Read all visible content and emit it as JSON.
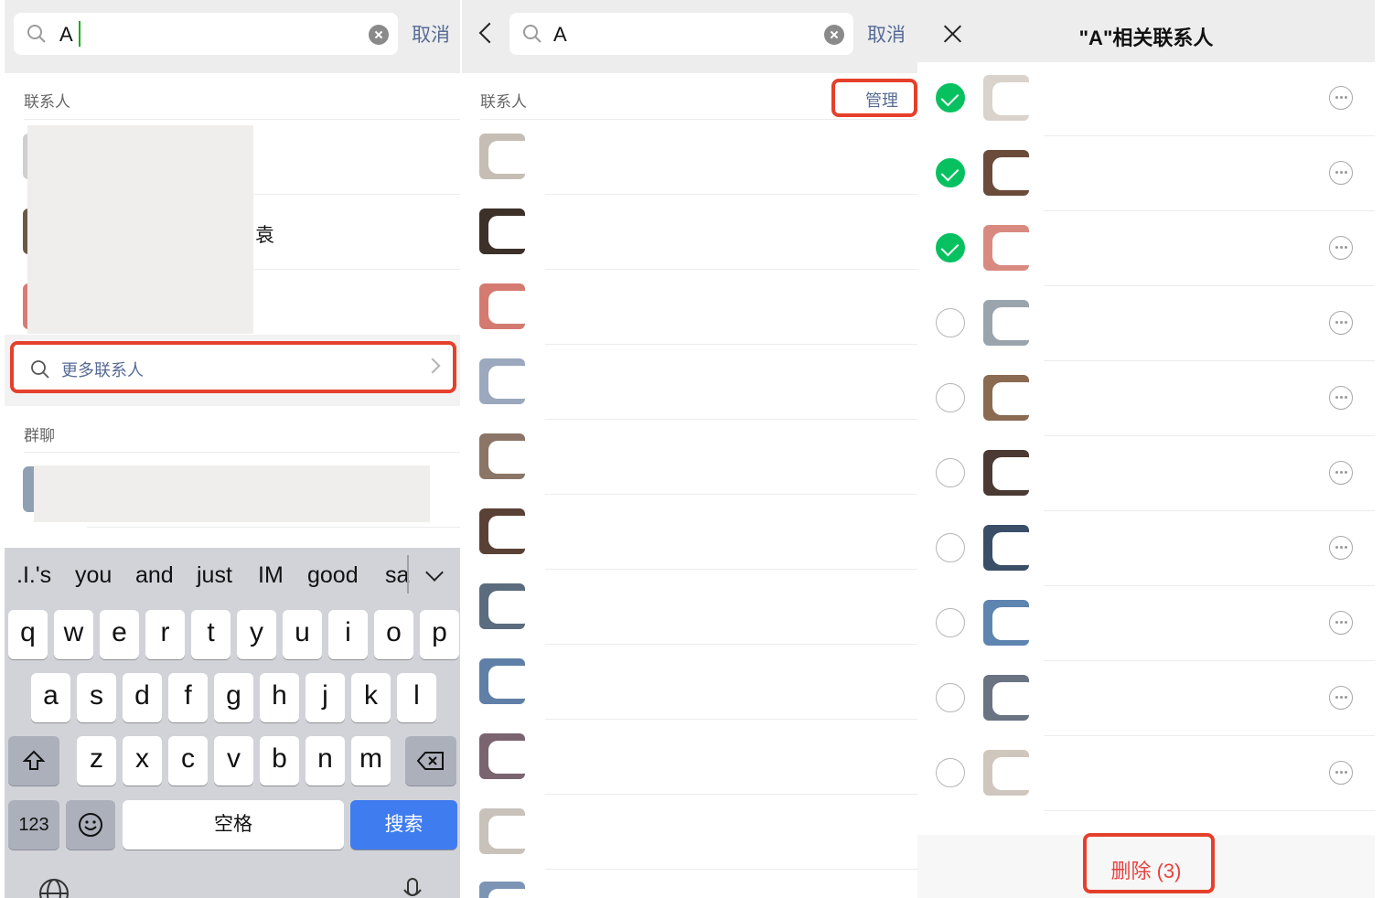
{
  "panel1": {
    "search": {
      "value": "A",
      "cancel": "取消"
    },
    "contacts_label": "联系人",
    "contact_fragment": "袁",
    "more_contacts": "更多联系人",
    "groups_label": "群聊",
    "suggestions": [
      ".I.'s",
      "you",
      "and",
      "just",
      "IM",
      "good",
      "sa"
    ],
    "keys_row1": [
      "q",
      "w",
      "e",
      "r",
      "t",
      "y",
      "u",
      "i",
      "o",
      "p"
    ],
    "keys_row2": [
      "a",
      "s",
      "d",
      "f",
      "g",
      "h",
      "j",
      "k",
      "l"
    ],
    "keys_row3": [
      "z",
      "x",
      "c",
      "v",
      "b",
      "n",
      "m"
    ],
    "key_numbers": "123",
    "key_space": "空格",
    "key_search": "搜索"
  },
  "panel2": {
    "search": {
      "value": "A",
      "cancel": "取消"
    },
    "contacts_label": "联系人",
    "manage": "管理"
  },
  "panel3": {
    "title": "\"A\"相关联系人",
    "delete": "删除 (3)",
    "rows": [
      {
        "checked": true
      },
      {
        "checked": true
      },
      {
        "checked": true
      },
      {
        "checked": false
      },
      {
        "checked": false
      },
      {
        "checked": false
      },
      {
        "checked": false
      },
      {
        "checked": false
      },
      {
        "checked": false
      },
      {
        "checked": false
      }
    ]
  },
  "colors": {
    "accent_link": "#576b95",
    "highlight": "#e5402b",
    "check_green": "#07c160",
    "delete_red": "#e64340",
    "search_button": "#3f7cf0"
  }
}
